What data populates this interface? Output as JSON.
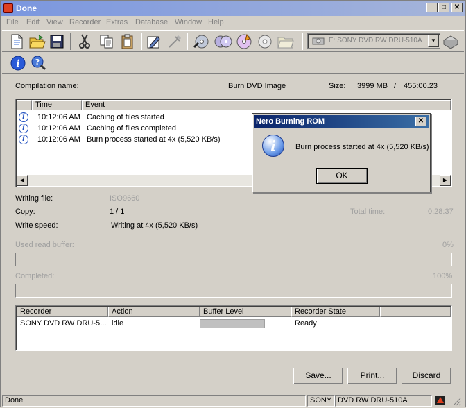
{
  "window": {
    "title": "Done"
  },
  "menu": [
    "File",
    "Edit",
    "View",
    "Recorder",
    "Extras",
    "Database",
    "Window",
    "Help"
  ],
  "drive": {
    "selected": "E: SONY    DVD RW DRU-510A"
  },
  "compilation": {
    "name_label": "Compilation name:",
    "name_value": "Burn DVD Image",
    "size_label": "Size:",
    "size_mb": "3999 MB",
    "size_sep": "/",
    "size_time": "455:00.23"
  },
  "log": {
    "columns": [
      "Time",
      "Event"
    ],
    "rows": [
      {
        "time": "10:12:06 AM",
        "event": "Caching of files started"
      },
      {
        "time": "10:12:06 AM",
        "event": "Caching of files completed"
      },
      {
        "time": "10:12:06 AM",
        "event": "Burn process started at 4x (5,520 KB/s)"
      }
    ]
  },
  "status": {
    "writing_file_label": "Writing file:",
    "writing_file_value": "ISO9660",
    "copy_label": "Copy:",
    "copy_value": "1 / 1",
    "total_time_label": "Total time:",
    "total_time_value": "0:28:37",
    "write_speed_label": "Write speed:",
    "write_speed_value": "Writing at 4x (5,520 KB/s)",
    "used_buffer_label": "Used read buffer:",
    "used_buffer_percent": "0%",
    "used_buffer_fraction": 0,
    "completed_label": "Completed:",
    "completed_percent": "100%",
    "completed_fraction": 1.0
  },
  "recorders": {
    "columns": [
      "Recorder",
      "Action",
      "Buffer Level",
      "Recorder State"
    ],
    "rows": [
      {
        "recorder": "SONY DVD RW DRU-5...",
        "action": "idle",
        "buffer_level": "",
        "state": "Ready"
      }
    ]
  },
  "buttons": {
    "save": "Save...",
    "print": "Print...",
    "discard": "Discard"
  },
  "statusbar": {
    "left": "Done",
    "vendor": "SONY",
    "model": "DVD RW DRU-510A"
  },
  "dialog": {
    "title": "Nero Burning ROM",
    "message": "Burn process started at 4x (5,520 KB/s)",
    "ok": "OK"
  },
  "colors": {
    "title_active": "#0a246a",
    "title_inactive": "#7a96df",
    "face": "#d4d0c8"
  }
}
